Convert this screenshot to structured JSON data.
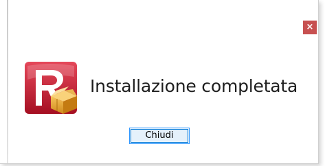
{
  "dialog": {
    "close_glyph": "×",
    "message": "Installazione completata",
    "icon": "installer-app-icon",
    "buttons": {
      "close_label": "Chiudi"
    }
  },
  "colors": {
    "close_button": "#c75050",
    "icon_red": "#c8102e",
    "button_border": "#0078d7",
    "button_fill": "#e5f1fb"
  }
}
